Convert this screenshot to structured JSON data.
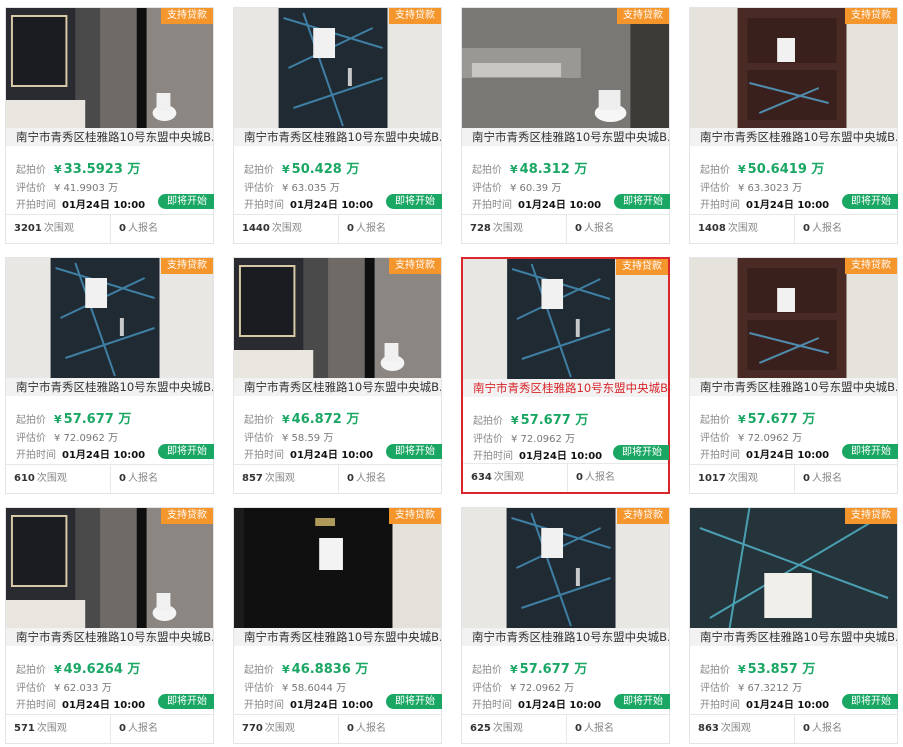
{
  "labels": {
    "badge": "支持贷款",
    "start_price": "起拍价",
    "assess": "评估价",
    "start_time": "开拍时间",
    "soon": "即将开始",
    "views_suffix": "次围观",
    "signup_suffix": "人报名",
    "currency": "¥"
  },
  "items": [
    {
      "title": "南宁市青秀区桂雅路10号东盟中央城B...",
      "price": "33.5923 万",
      "assess": "¥ 41.9903 万",
      "time": "01月24日 10:00",
      "views": "3201",
      "signups": "0",
      "scene": "bathroom"
    },
    {
      "title": "南宁市青秀区桂雅路10号东盟中央城B...",
      "price": "50.428 万",
      "assess": "¥ 63.035 万",
      "time": "01月24日 10:00",
      "views": "1440",
      "signups": "0",
      "scene": "door-wrapped"
    },
    {
      "title": "南宁市青秀区桂雅路10号东盟中央城B...",
      "price": "48.312 万",
      "assess": "¥ 60.39 万",
      "time": "01月24日 10:00",
      "views": "728",
      "signups": "0",
      "scene": "bathroom-grey"
    },
    {
      "title": "南宁市青秀区桂雅路10号东盟中央城B...",
      "price": "50.6419 万",
      "assess": "¥ 63.3023 万",
      "time": "01月24日 10:00",
      "views": "1408",
      "signups": "0",
      "scene": "door-red"
    },
    {
      "title": "南宁市青秀区桂雅路10号东盟中央城B...",
      "price": "57.677 万",
      "assess": "¥ 72.0962 万",
      "time": "01月24日 10:00",
      "views": "610",
      "signups": "0",
      "scene": "door-wrapped"
    },
    {
      "title": "南宁市青秀区桂雅路10号东盟中央城B...",
      "price": "46.872 万",
      "assess": "¥ 58.59 万",
      "time": "01月24日 10:00",
      "views": "857",
      "signups": "0",
      "scene": "bathroom"
    },
    {
      "title": "南宁市青秀区桂雅路10号东盟中央城B...",
      "price": "57.677 万",
      "assess": "¥ 72.0962 万",
      "time": "01月24日 10:00",
      "views": "634",
      "signups": "0",
      "scene": "door-wrapped",
      "active": true
    },
    {
      "title": "南宁市青秀区桂雅路10号东盟中央城B...",
      "price": "57.677 万",
      "assess": "¥ 72.0962 万",
      "time": "01月24日 10:00",
      "views": "1017",
      "signups": "0",
      "scene": "door-red"
    },
    {
      "title": "南宁市青秀区桂雅路10号东盟中央城B...",
      "price": "49.6264 万",
      "assess": "¥ 62.033 万",
      "time": "01月24日 10:00",
      "views": "571",
      "signups": "0",
      "scene": "bathroom"
    },
    {
      "title": "南宁市青秀区桂雅路10号东盟中央城B...",
      "price": "46.8836 万",
      "assess": "¥ 58.6044 万",
      "time": "01月24日 10:00",
      "views": "770",
      "signups": "0",
      "scene": "door-black"
    },
    {
      "title": "南宁市青秀区桂雅路10号东盟中央城B...",
      "price": "57.677 万",
      "assess": "¥ 72.0962 万",
      "time": "01月24日 10:00",
      "views": "625",
      "signups": "0",
      "scene": "door-wrapped"
    },
    {
      "title": "南宁市青秀区桂雅路10号东盟中央城B...",
      "price": "53.857 万",
      "assess": "¥ 67.3212 万",
      "time": "01月24日 10:00",
      "views": "863",
      "signups": "0",
      "scene": "door-wrapped-teal"
    }
  ]
}
